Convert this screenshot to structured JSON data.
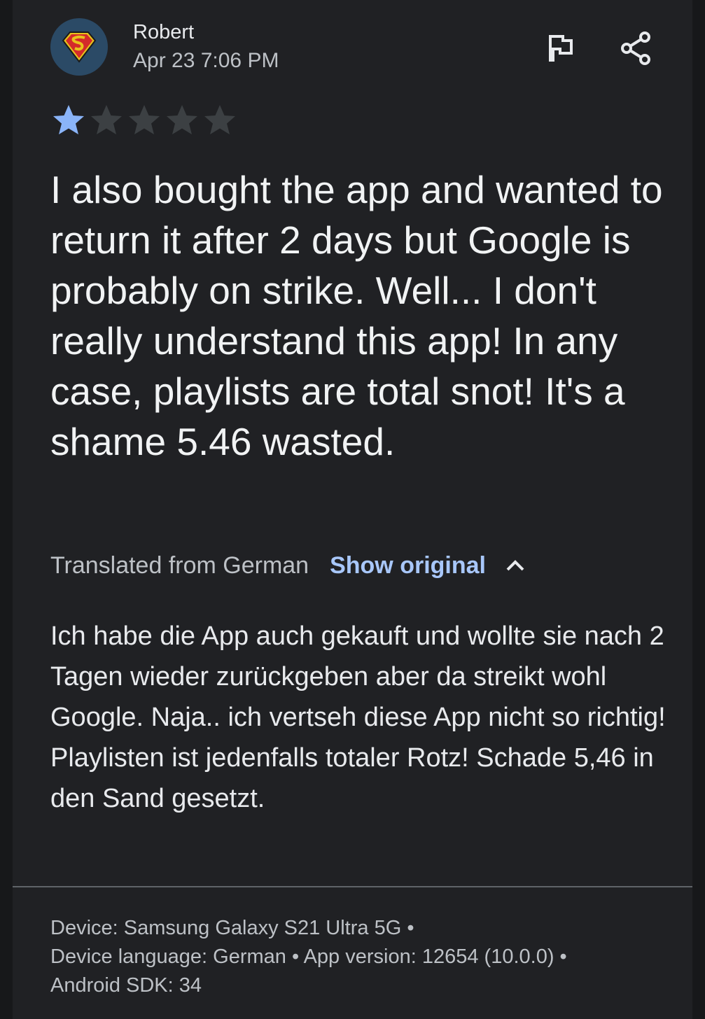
{
  "review": {
    "author": "Robert",
    "date": "Apr 23 7:06 PM",
    "avatar_icon": "superman-logo-avatar",
    "rating": 1,
    "rating_max": 5,
    "star_filled_color": "#8ab4f8",
    "star_empty_color": "#3c4043",
    "text": "I also bought the app and wanted to return it after 2 days but Google is probably on strike. Well... I don't really understand this app! In any case, playlists are total snot! It's a shame 5.46 wasted.",
    "translated_label": "Translated from German",
    "show_original_label": "Show original",
    "original_text": "Ich habe die App auch gekauft und wollte sie nach 2 Tagen wieder zurückgeben aber da streikt wohl Google. Naja.. ich vertseh diese App nicht so richtig! Playlisten ist jedenfalls totaler Rotz! Schade 5,46 in den Sand gesetzt."
  },
  "actions": {
    "flag_icon": "flag-icon",
    "share_icon": "share-icon"
  },
  "device_info": {
    "line1": "Device: Samsung Galaxy S21 Ultra 5G •",
    "line2": "Device language: German • App version: 12654 (10.0.0) •",
    "line3": "Android SDK: 34"
  }
}
